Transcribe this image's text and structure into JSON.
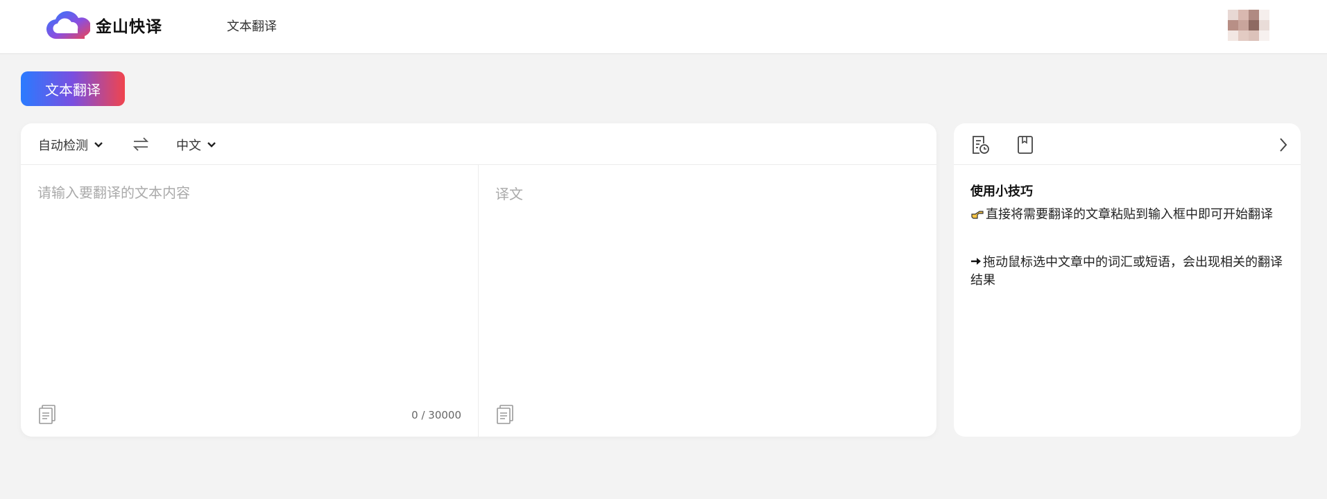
{
  "header": {
    "logo_text": "金山快译",
    "nav_label": "文本翻译"
  },
  "tab": {
    "label": "文本翻译"
  },
  "translator": {
    "source_lang": "自动检测",
    "target_lang": "中文",
    "input_placeholder": "请输入要翻译的文本内容",
    "output_placeholder": "译文",
    "char_counter": "0 / 30000"
  },
  "tips": {
    "title": "使用小技巧",
    "items": [
      {
        "icon": "pointing-hand-icon",
        "text": "直接将需要翻译的文章粘贴到输入框中即可开始翻译"
      },
      {
        "icon": "right-arrow-icon",
        "text": "拖动鼠标选中文章中的词汇或短语，会出现相关的翻译结果"
      }
    ]
  },
  "colors": {
    "accent_start": "#2a7bff",
    "accent_end": "#f0444d",
    "background": "#f3f3f3"
  }
}
